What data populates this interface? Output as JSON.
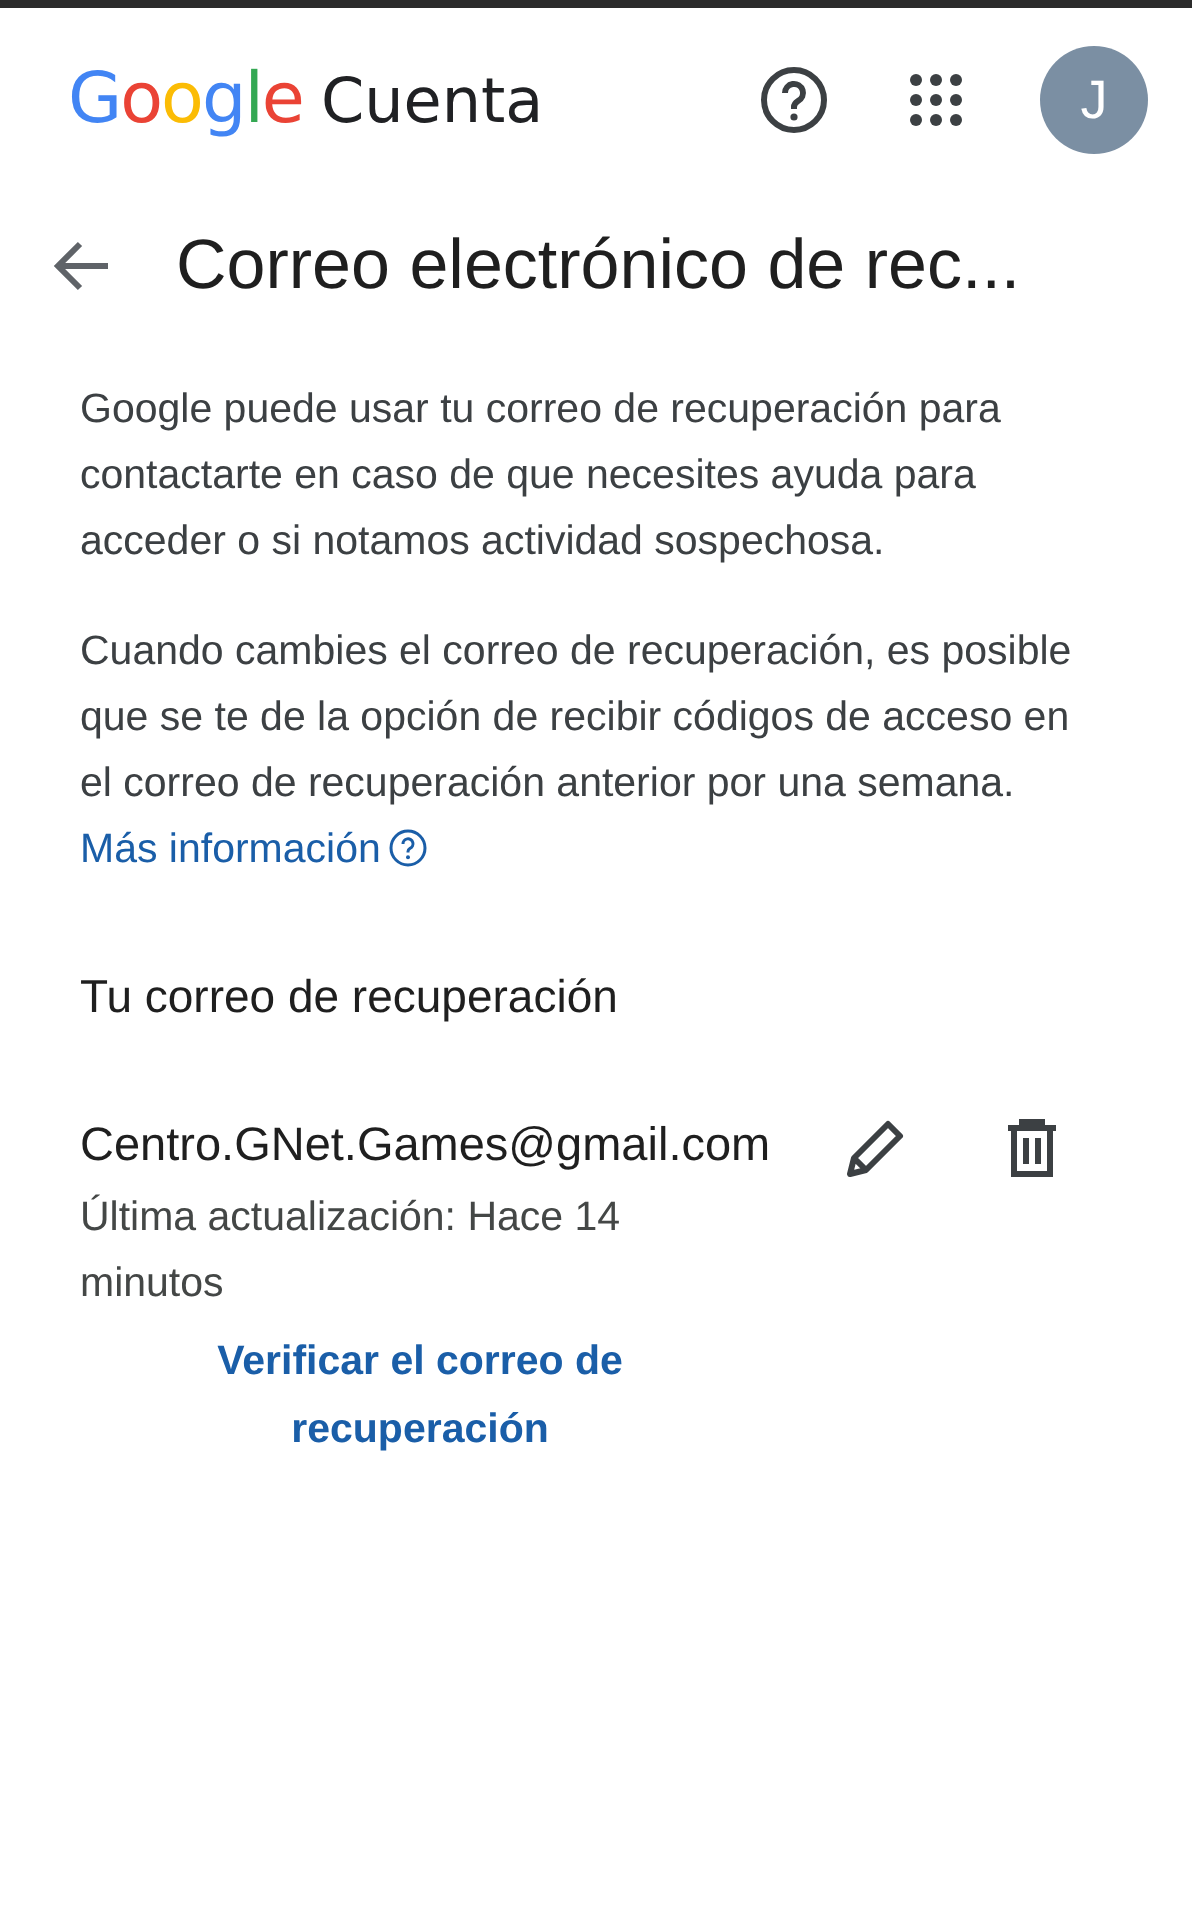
{
  "header": {
    "logo": "Google",
    "product": "Cuenta",
    "avatar_letter": "J"
  },
  "page_title": "Correo electrónico de rec...",
  "paragraphs": [
    "Google puede usar tu correo de recuperación para contactarte en caso de que necesites ayuda para acceder o si notamos actividad sospechosa.",
    "Cuando cambies el correo de recuperación, es posible que se te de la opción de recibir códigos de acceso en el correo de recuperación anterior por una semana."
  ],
  "more_info_link": "Más información",
  "section_title": "Tu correo de recuperación",
  "recovery_email": {
    "address": "Centro.GNet.Games@gmail.com",
    "updated": "Última actualización: Hace 14 minutos",
    "verify_link": "Verificar el correo de recuperación"
  }
}
